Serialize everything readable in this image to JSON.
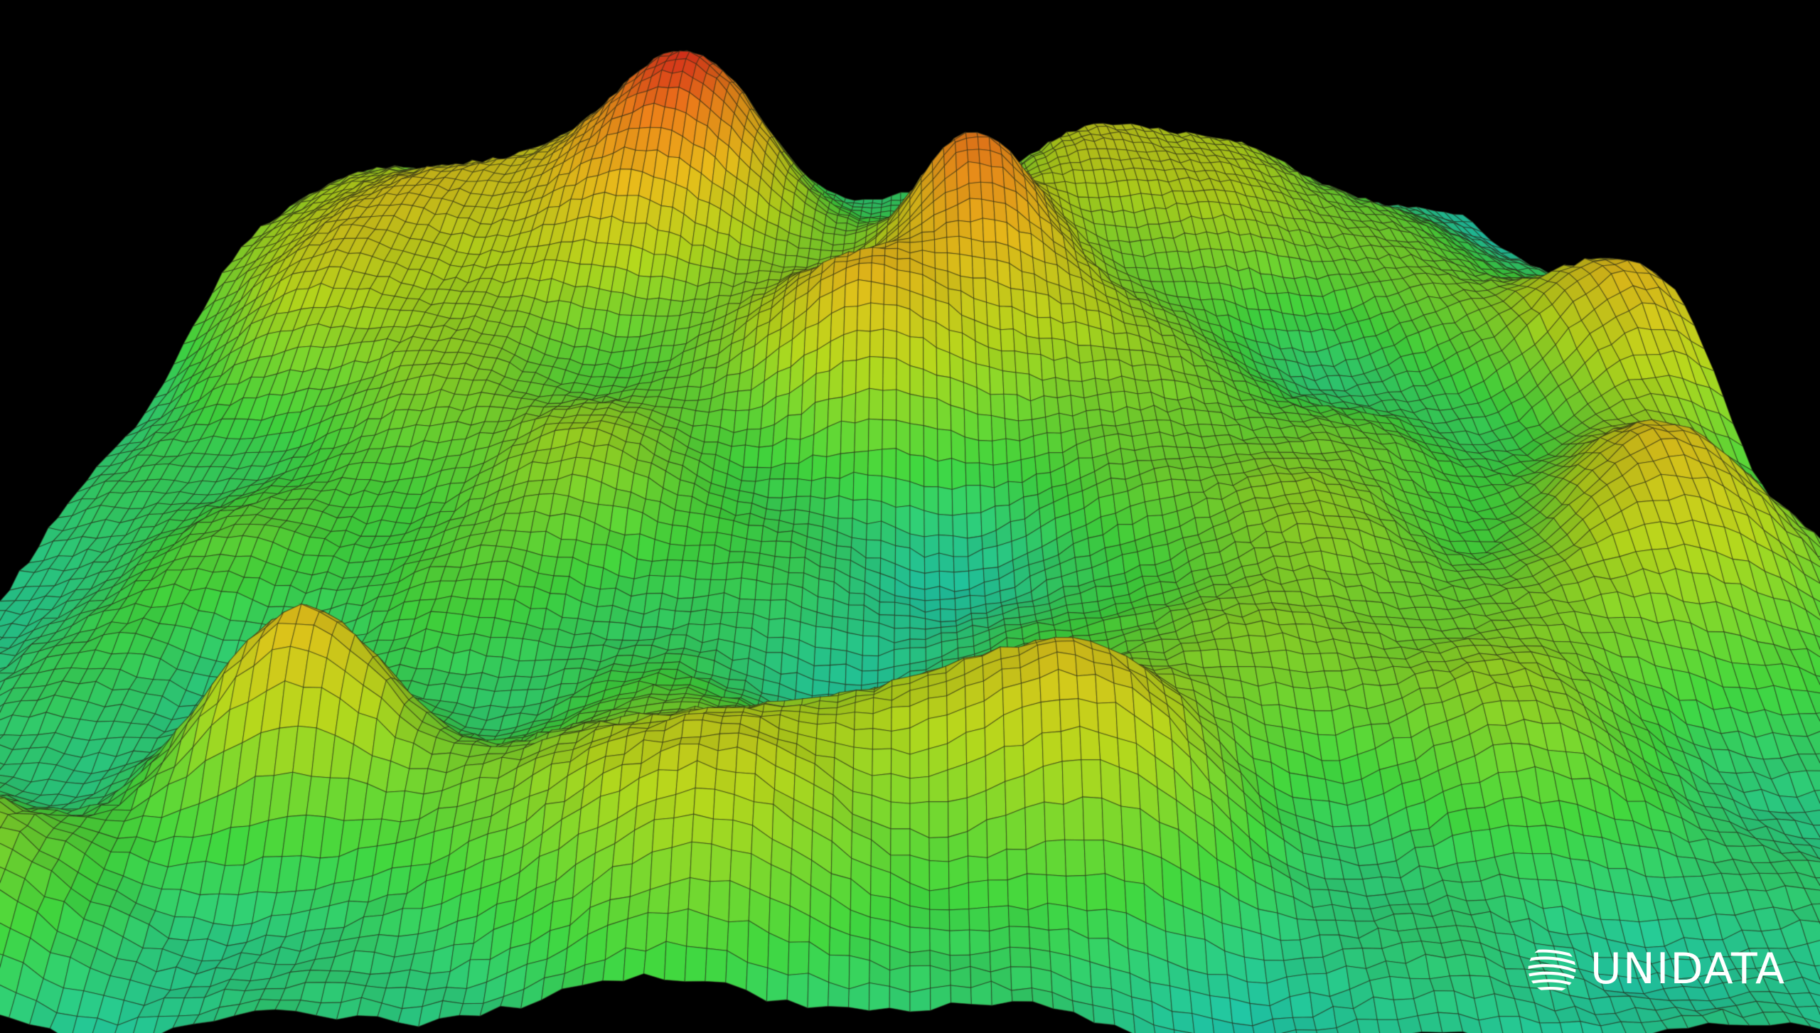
{
  "scene": {
    "description_tag": "terrain-wireframe",
    "background_color": "#000000",
    "wireframe_color": "#2a2a1a",
    "height_colors": {
      "low": "#18b8b0",
      "mid_low": "#3cc83a",
      "mid": "#a8c81a",
      "mid_high": "#d8b018",
      "high": "#e07818",
      "peak": "#d8301a"
    }
  },
  "watermark": {
    "text": "UNIDATA",
    "icon": "globe-logo-icon"
  }
}
